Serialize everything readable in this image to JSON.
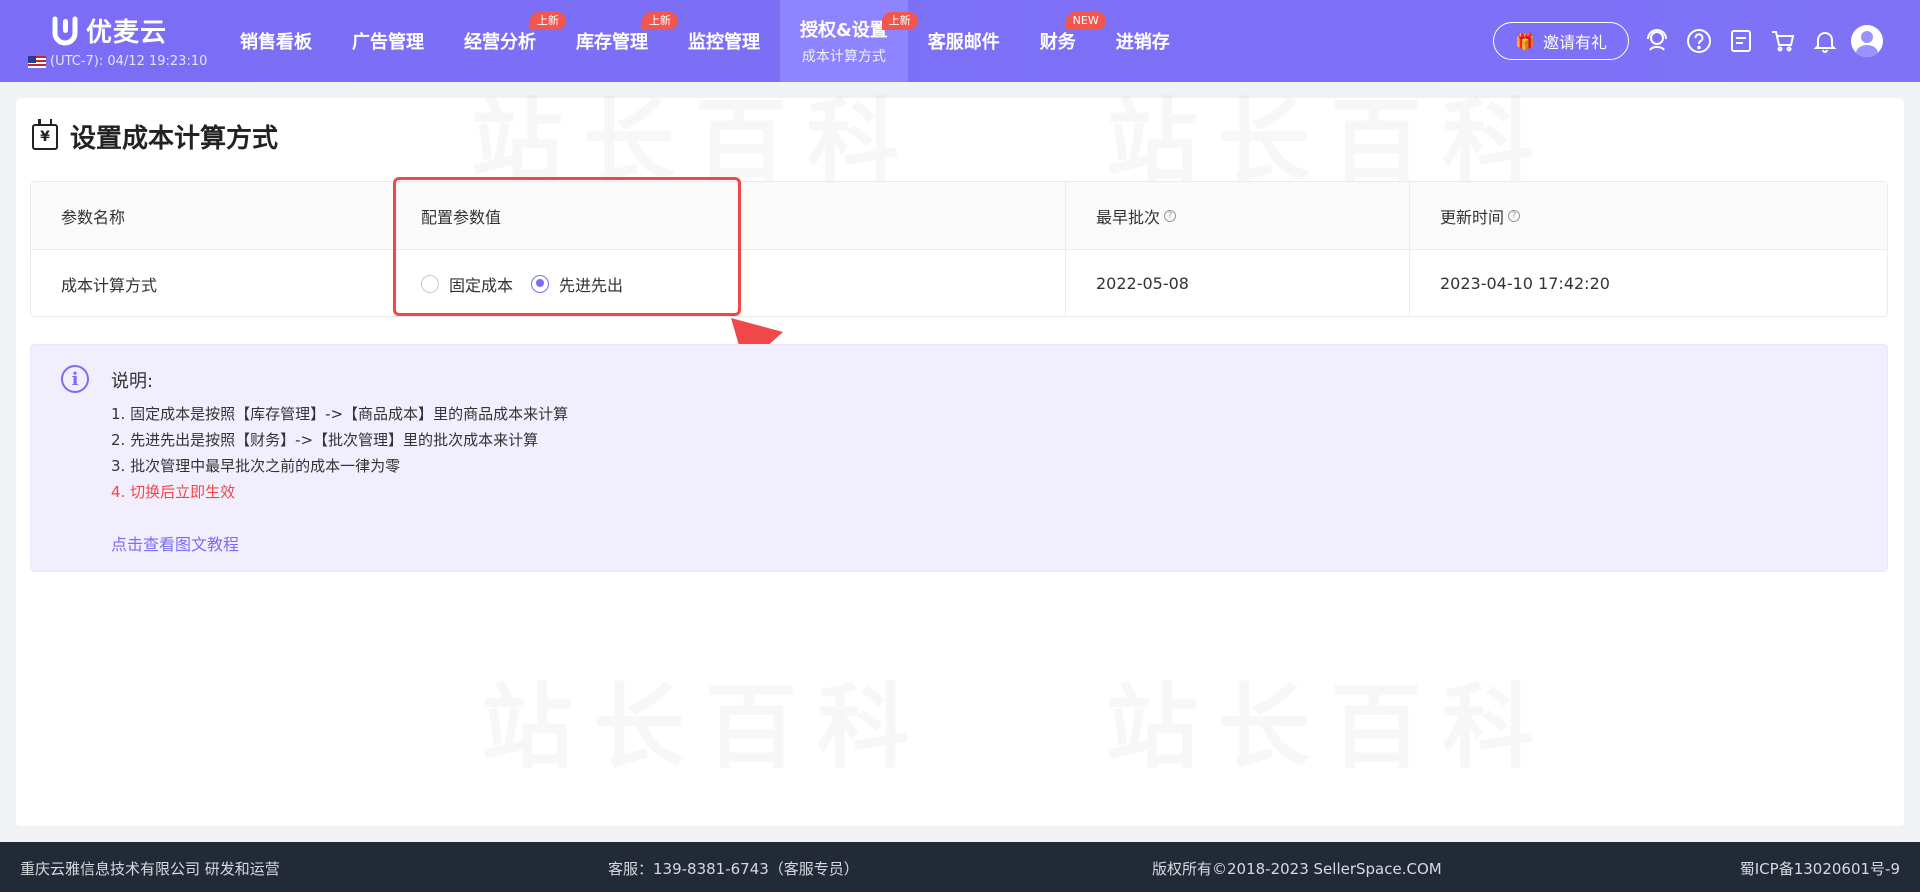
{
  "header": {
    "brand": "优麦云",
    "clock": "(UTC-7): 04/12 19:23:10",
    "nav": [
      {
        "label": "销售看板",
        "badge": ""
      },
      {
        "label": "广告管理",
        "badge": ""
      },
      {
        "label": "经营分析",
        "badge": "上新"
      },
      {
        "label": "库存管理",
        "badge": "上新"
      },
      {
        "label": "监控管理",
        "badge": ""
      },
      {
        "label": "授权&设置",
        "badge": "上新",
        "sub": "成本计算方式",
        "active": true
      },
      {
        "label": "客服邮件",
        "badge": ""
      },
      {
        "label": "财务",
        "badge": "NEW"
      },
      {
        "label": "进销存",
        "badge": ""
      }
    ],
    "invite_label": "邀请有礼",
    "icons": [
      "support-icon",
      "help-icon",
      "feedback-icon",
      "cart-icon",
      "bell-icon",
      "avatar"
    ]
  },
  "page": {
    "title": "设置成本计算方式",
    "title_icon_glyph": "¥"
  },
  "table": {
    "headers": [
      "参数名称",
      "配置参数值",
      "最早批次",
      "更新时间"
    ],
    "row": {
      "name": "成本计算方式",
      "options": [
        {
          "label": "固定成本",
          "checked": false
        },
        {
          "label": "先进先出",
          "checked": true
        }
      ],
      "earliest_batch": "2022-05-08",
      "updated_at": "2023-04-10 17:42:20"
    }
  },
  "info": {
    "title": "说明:",
    "lines": [
      "1. 固定成本是按照【库存管理】->【商品成本】里的商品成本来计算",
      "2. 先进先出是按照【财务】->【批次管理】里的批次成本来计算",
      "3. 批次管理中最早批次之前的成本一律为零",
      "4. 切换后立即生效"
    ],
    "link": "点击查看图文教程"
  },
  "footer": {
    "company": "重庆云雅信息技术有限公司 研发和运营",
    "service": "客服：139-8381-6743（客服专员）",
    "copyright": "版权所有©2018-2023 SellerSpace.COM",
    "icp": "蜀ICP备13020601号-9"
  },
  "watermark": "站长百科",
  "colors": {
    "header_bg": "#7b6df5",
    "accent": "#7b6df5",
    "badge": "#f3564e",
    "highlight": "#f04848",
    "footer_bg": "#222a37"
  }
}
